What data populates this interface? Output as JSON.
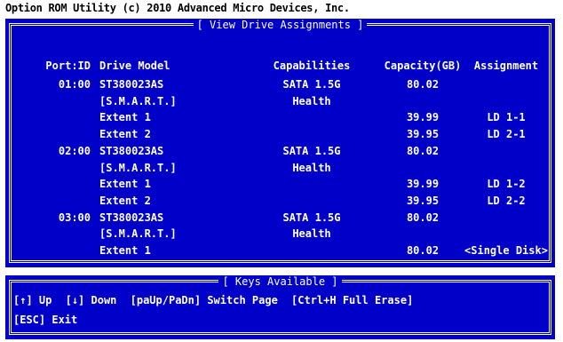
{
  "app_title": "Option ROM Utility (c) 2010 Advanced Micro Devices, Inc.",
  "panel_title": "[ View Drive Assignments ]",
  "columns": {
    "port": "Port:ID",
    "model": "Drive Model",
    "capabilities": "Capabilities",
    "capacity": "Capacity(GB)",
    "assignment": "Assignment"
  },
  "rows": [
    {
      "port": "01:00",
      "model": "ST380023AS",
      "cap": "SATA 1.5G",
      "size": "80.02",
      "assign": ""
    },
    {
      "port": "",
      "model": "[S.M.A.R.T.]",
      "cap": "Health",
      "size": "",
      "assign": ""
    },
    {
      "port": "",
      "model": "Extent 1",
      "cap": "",
      "size": "39.99",
      "assign": "LD 1-1"
    },
    {
      "port": "",
      "model": "Extent 2",
      "cap": "",
      "size": "39.95",
      "assign": "LD 2-1"
    },
    {
      "port": "02:00",
      "model": "ST380023AS",
      "cap": "SATA 1.5G",
      "size": "80.02",
      "assign": ""
    },
    {
      "port": "",
      "model": "[S.M.A.R.T.]",
      "cap": "Health",
      "size": "",
      "assign": ""
    },
    {
      "port": "",
      "model": "Extent 1",
      "cap": "",
      "size": "39.99",
      "assign": "LD 1-2"
    },
    {
      "port": "",
      "model": "Extent 2",
      "cap": "",
      "size": "39.95",
      "assign": "LD 2-2"
    },
    {
      "port": "03:00",
      "model": "ST380023AS",
      "cap": "SATA 1.5G",
      "size": "80.02",
      "assign": ""
    },
    {
      "port": "",
      "model": "[S.M.A.R.T.]",
      "cap": "Health",
      "size": "",
      "assign": ""
    },
    {
      "port": "",
      "model": "Extent 1",
      "cap": "",
      "size": "80.02",
      "assign": "<Single Disk>"
    }
  ],
  "keys_title": "[ Keys Available ]",
  "keys": {
    "up": "[↑] Up",
    "down": "[↓] Down",
    "page": "[paUp/PaDn] Switch Page",
    "erase": "[Ctrl+H Full Erase]",
    "exit": "[ESC] Exit"
  },
  "colors": {
    "panel": "#0000c8",
    "text": "#ffffff"
  }
}
